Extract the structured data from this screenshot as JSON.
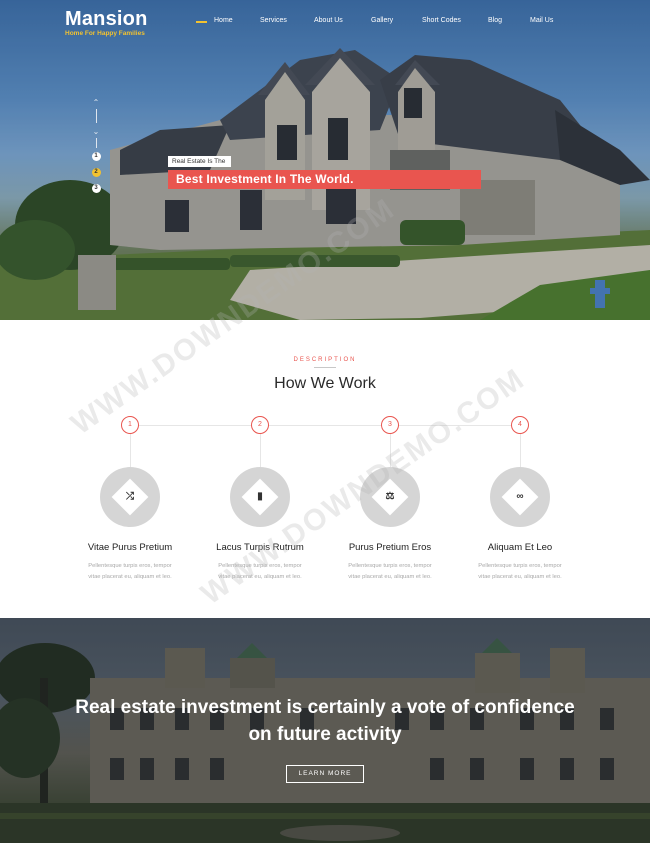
{
  "brand": {
    "name": "Mansion",
    "tagline": "Home For Happy Families"
  },
  "nav": {
    "items": [
      {
        "label": "Home",
        "active": true
      },
      {
        "label": "Services"
      },
      {
        "label": "About Us"
      },
      {
        "label": "Gallery"
      },
      {
        "label": "Short Codes"
      },
      {
        "label": "Blog"
      },
      {
        "label": "Mail Us"
      }
    ]
  },
  "hero": {
    "slides": [
      "1",
      "2",
      "3"
    ],
    "active_slide": 2,
    "caption_small": "Real Estate Is The",
    "caption_big": "Best Investment In The World."
  },
  "how": {
    "eyebrow": "DESCRIPTION",
    "title": "How We Work",
    "steps": [
      {
        "num": "1",
        "icon": "shuffle-icon",
        "glyph": "⤮",
        "title": "Vitae Purus Pretium",
        "text1": "Pellentesque turpis eros, tempor",
        "text2": "vitae placerat eu, aliquam et leo."
      },
      {
        "num": "2",
        "icon": "bar-chart-icon",
        "glyph": "▮",
        "title": "Lacus Turpis Rutrum",
        "text1": "Pellentesque turpis eros, tempor",
        "text2": "vitae placerat eu, aliquam et leo."
      },
      {
        "num": "3",
        "icon": "gavel-icon",
        "glyph": "⚖",
        "title": "Purus Pretium Eros",
        "text1": "Pellentesque turpis eros, tempor",
        "text2": "vitae placerat eu, aliquam et leo."
      },
      {
        "num": "4",
        "icon": "link-icon",
        "glyph": "∞",
        "title": "Aliquam Et Leo",
        "text1": "Pellentesque turpis eros, tempor",
        "text2": "vitae placerat eu, aliquam et leo."
      }
    ]
  },
  "banner": {
    "line1": "Real estate investment is certainly a vote of confidence",
    "line2": "on future activity",
    "button": "LEARN MORE"
  },
  "watermark": "WWW.DOWNDEMO.COM",
  "colors": {
    "accent": "#e9554f",
    "brand_yellow": "#f2c230"
  }
}
